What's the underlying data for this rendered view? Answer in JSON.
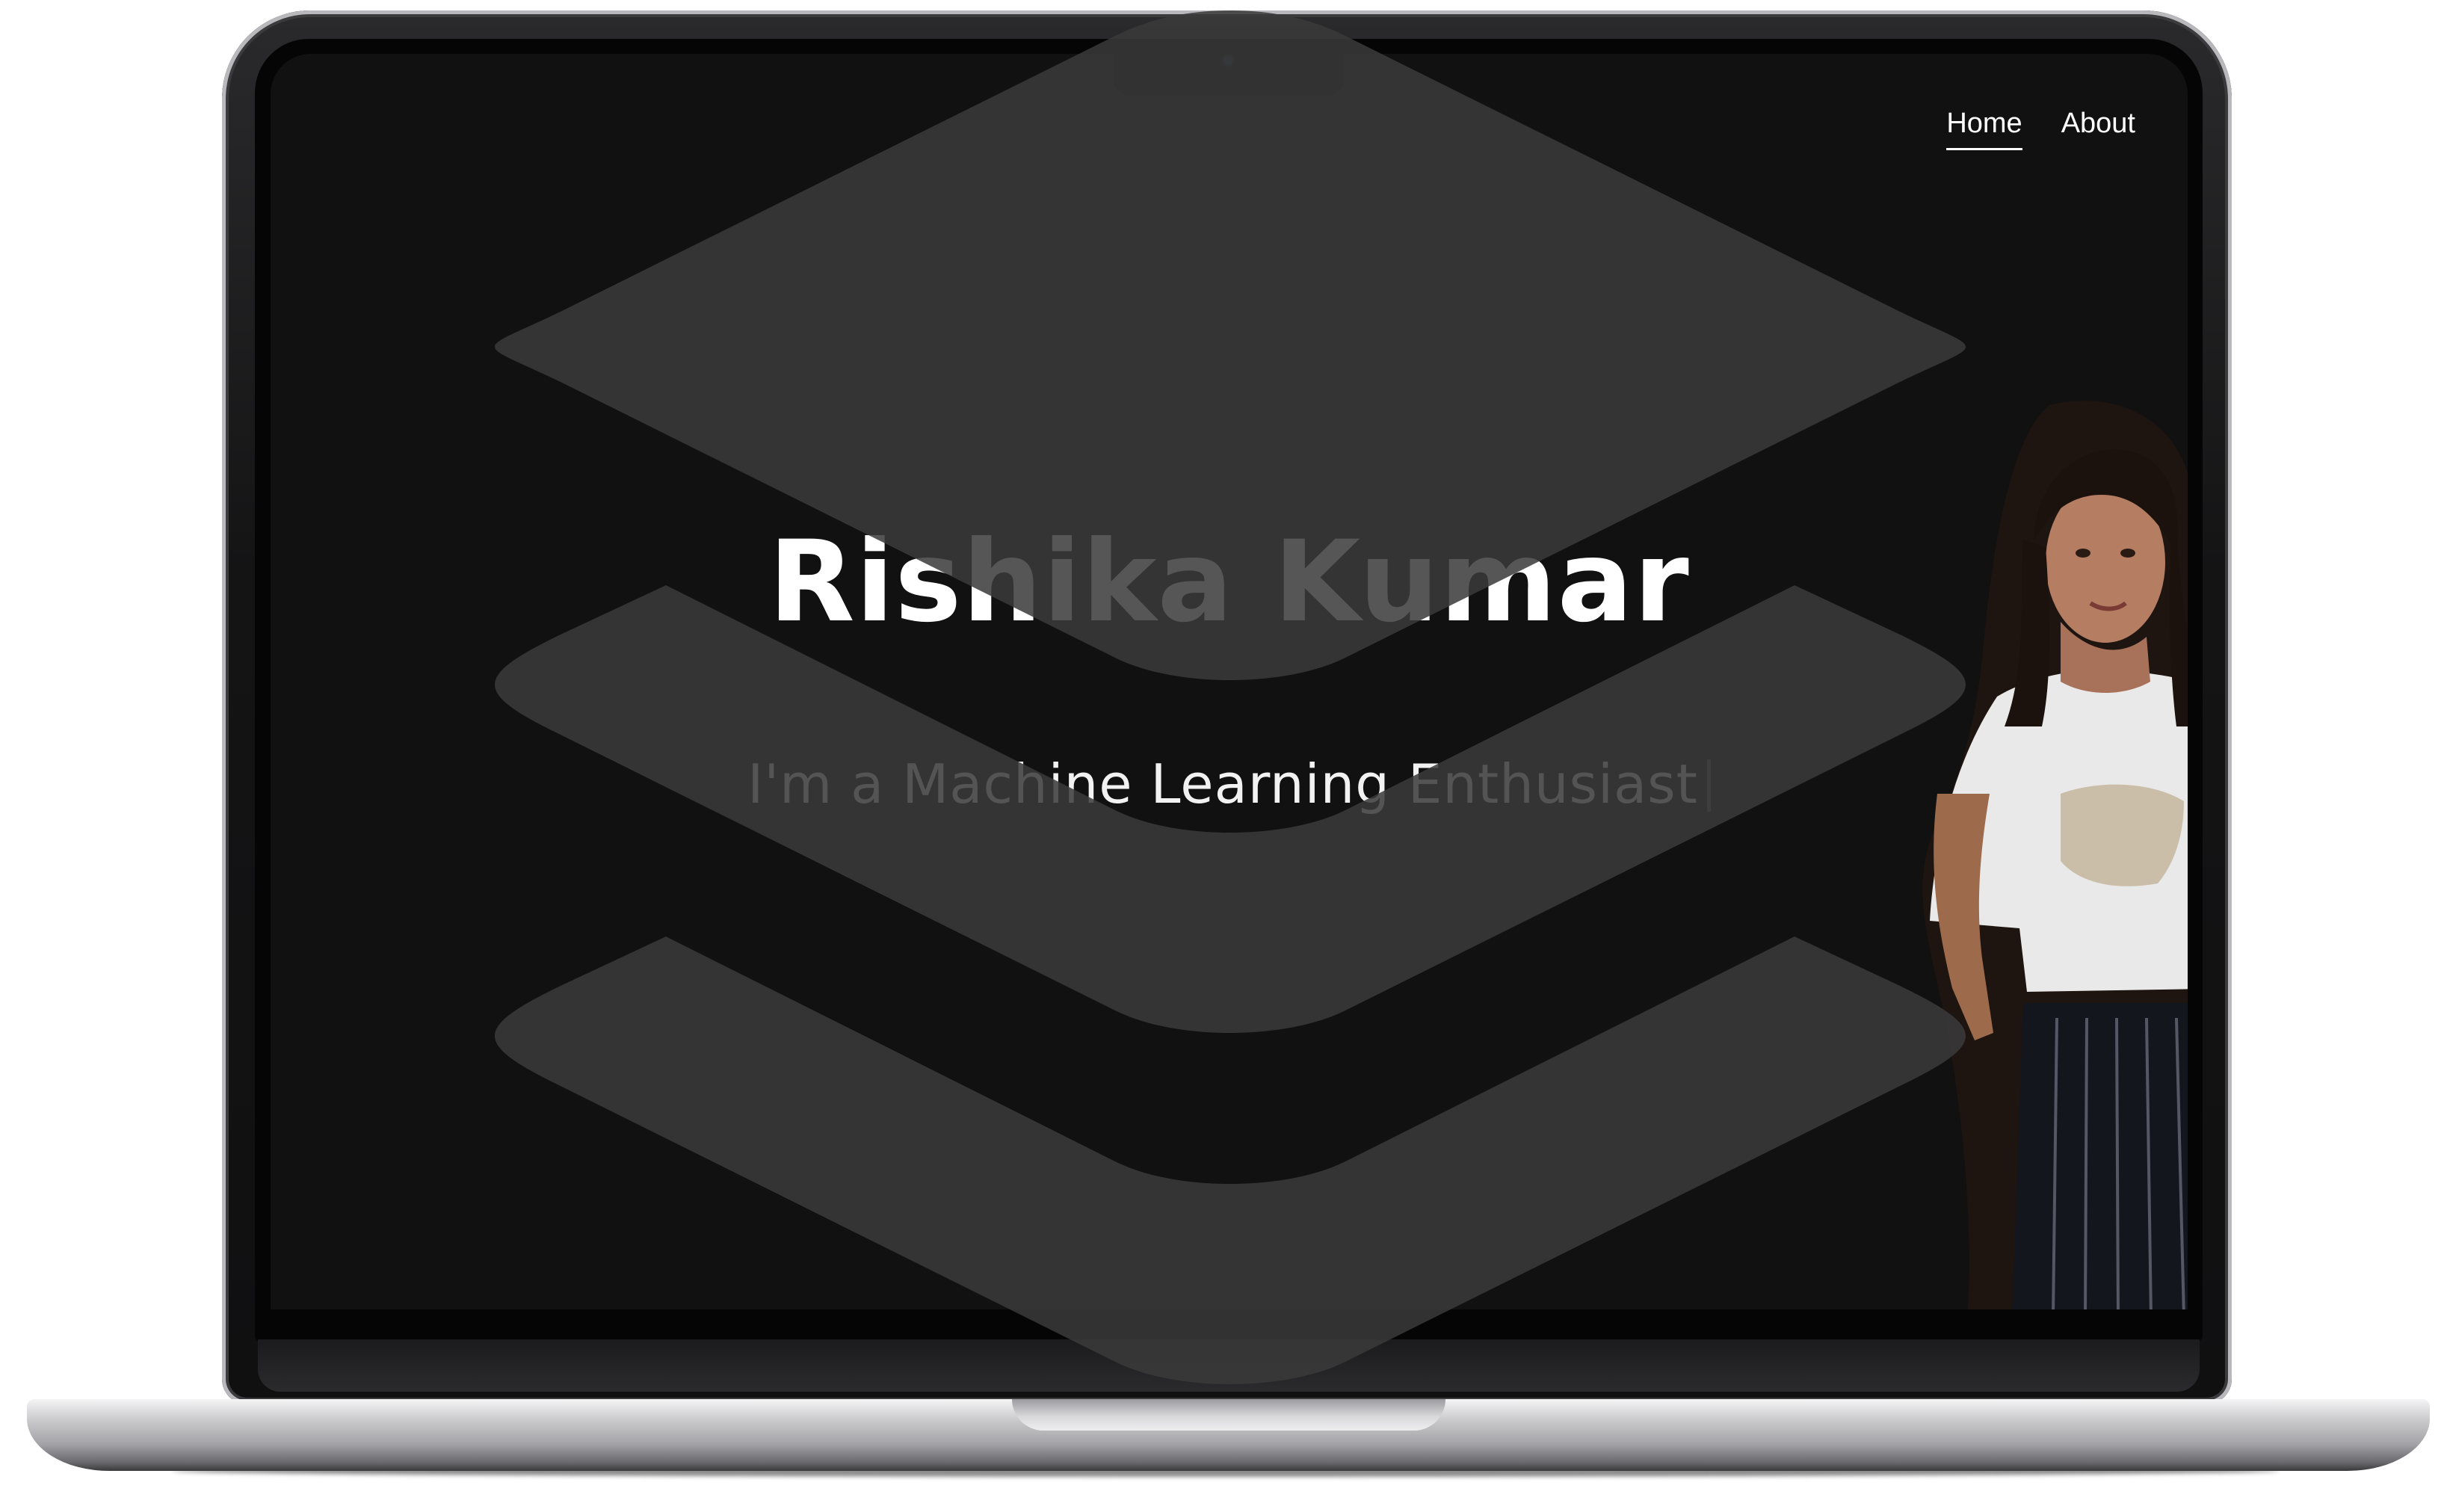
{
  "nav": {
    "items": [
      {
        "label": "Home",
        "active": true
      },
      {
        "label": "About",
        "active": false
      }
    ]
  },
  "hero": {
    "name": "Rishika Kumar",
    "tagline": "I'm a Machine Learning Enthusiast"
  },
  "overlay": {
    "icon": "layers-stack-icon",
    "color": "#3a3a3a"
  },
  "colors": {
    "page_background": "#111111",
    "text": "#ffffff"
  }
}
